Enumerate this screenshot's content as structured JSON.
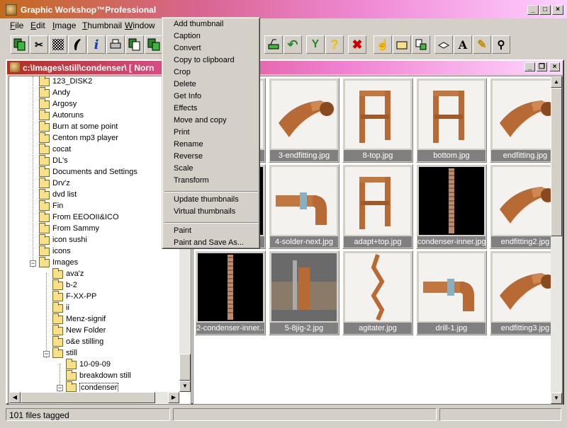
{
  "window": {
    "title": "Graphic Workshop™Professional",
    "controls": [
      "_",
      "□",
      "×"
    ]
  },
  "menubar": [
    "File",
    "Edit",
    "Image",
    "Thumbnail",
    "Window"
  ],
  "toolbar": {
    "buttons": [
      "copy-icon",
      "scissors-icon",
      "dither-icon",
      "feather-icon",
      "info-icon",
      "print-icon",
      "copy-files-icon",
      "move-files-icon",
      "reduce-icon",
      "undo-icon",
      "magic-wand-icon",
      "help-icon",
      "delete-icon",
      "hand-icon",
      "folder-icon",
      "export-icon",
      "scanner-icon",
      "text-icon",
      "pencil-icon",
      "magnifier-icon"
    ]
  },
  "child_window": {
    "title": "c:\\Images\\still\\condenser\\ [ Norn",
    "controls": [
      "_",
      "❐",
      "×"
    ]
  },
  "tree": {
    "items": [
      {
        "label": "123_DISK2",
        "level": 1
      },
      {
        "label": "Andy",
        "level": 1
      },
      {
        "label": "Argosy",
        "level": 1
      },
      {
        "label": "Autoruns",
        "level": 1
      },
      {
        "label": "Burn at some point",
        "level": 1
      },
      {
        "label": "Centon mp3 player",
        "level": 1
      },
      {
        "label": "cocat",
        "level": 1
      },
      {
        "label": "DL's",
        "level": 1
      },
      {
        "label": "Documents and Settings",
        "level": 1
      },
      {
        "label": "Drv'z",
        "level": 1
      },
      {
        "label": "dvd list",
        "level": 1
      },
      {
        "label": "Fin",
        "level": 1
      },
      {
        "label": "From EEOOII&ICO",
        "level": 1
      },
      {
        "label": "From Sammy",
        "level": 1
      },
      {
        "label": "icon sushi",
        "level": 1
      },
      {
        "label": "icons",
        "level": 1
      },
      {
        "label": "Images",
        "level": 1,
        "expanded": true
      },
      {
        "label": "ava'z",
        "level": 2
      },
      {
        "label": "b-2",
        "level": 2
      },
      {
        "label": "F-XX-PP",
        "level": 2
      },
      {
        "label": "ii",
        "level": 2
      },
      {
        "label": "Menz-signif",
        "level": 2
      },
      {
        "label": "New Folder",
        "level": 2
      },
      {
        "label": "o&e stilling",
        "level": 2
      },
      {
        "label": "still",
        "level": 2,
        "expanded": true
      },
      {
        "label": "10-09-09",
        "level": 3
      },
      {
        "label": "breakdown still",
        "level": 3
      },
      {
        "label": "condenser",
        "level": 3,
        "selected": true,
        "expanded": true
      }
    ]
  },
  "thumbnails": [
    {
      "label": "",
      "art": "coil"
    },
    {
      "label": "3-endfitting.jpg",
      "art": "coil"
    },
    {
      "label": "8-top.jpg",
      "art": "pipe"
    },
    {
      "label": "bottom.jpg",
      "art": "pipe"
    },
    {
      "label": "endfitting.jpg",
      "art": "coil"
    },
    {
      "label": "",
      "art": "tall"
    },
    {
      "label": "4-solder-next.jpg",
      "art": "elbow"
    },
    {
      "label": "adapt+top.jpg",
      "art": "pipe"
    },
    {
      "label": "condenser-inner.jpg",
      "art": "tall"
    },
    {
      "label": "endfitting2.jpg",
      "art": "coil"
    },
    {
      "label": "2-condenser-inner...",
      "art": "tall"
    },
    {
      "label": "5-8jig-2.jpg",
      "art": "vise"
    },
    {
      "label": "agitater.jpg",
      "art": "twist"
    },
    {
      "label": "drill-1.jpg",
      "art": "elbow"
    },
    {
      "label": "endfitting3.jpg",
      "art": "coil"
    }
  ],
  "context_menu": {
    "items": [
      {
        "label": "Add thumbnail",
        "group": 1
      },
      {
        "label": "Caption",
        "group": 1
      },
      {
        "label": "Convert",
        "group": 1
      },
      {
        "label": "Copy to clipboard",
        "group": 1
      },
      {
        "label": "Crop",
        "group": 1
      },
      {
        "label": "Delete",
        "group": 1
      },
      {
        "label": "Get Info",
        "group": 1
      },
      {
        "label": "Effects",
        "group": 1
      },
      {
        "label": "Move and copy",
        "group": 1
      },
      {
        "label": "Print",
        "group": 1
      },
      {
        "label": "Rename",
        "group": 1
      },
      {
        "label": "Reverse",
        "group": 1
      },
      {
        "label": "Scale",
        "group": 1
      },
      {
        "label": "Transform",
        "group": 1
      },
      {
        "label": "Update thumbnails",
        "group": 2
      },
      {
        "label": "Virtual thumbnails",
        "group": 2
      },
      {
        "label": "Paint",
        "group": 3
      },
      {
        "label": "Paint and Save As...",
        "group": 3
      }
    ]
  },
  "status": {
    "text": "101 files tagged"
  }
}
